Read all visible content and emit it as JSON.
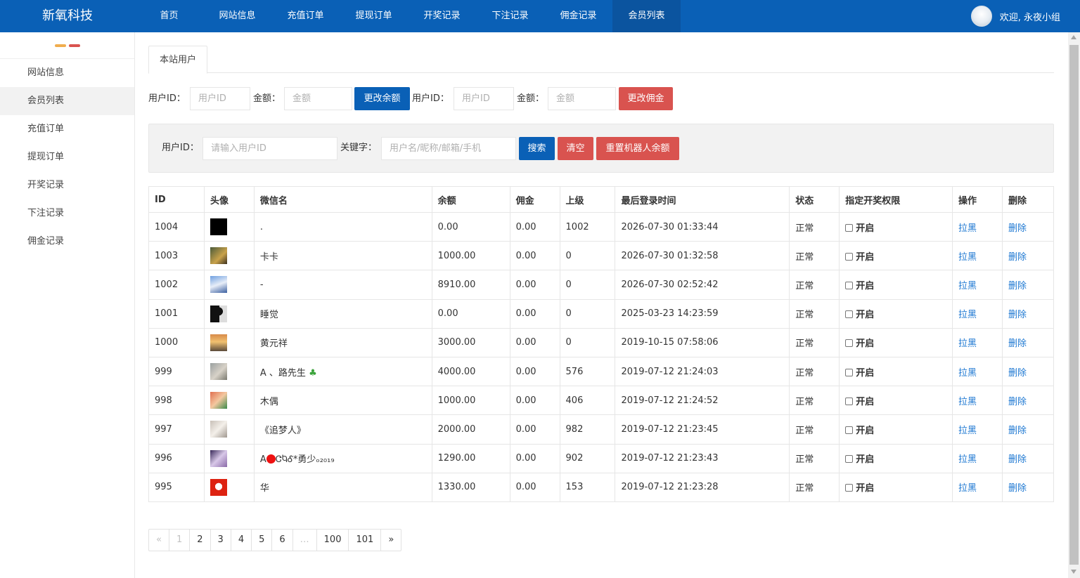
{
  "brand": "新氧科技",
  "nav": [
    "首页",
    "网站信息",
    "充值订单",
    "提现订单",
    "开奖记录",
    "下注记录",
    "佣金记录",
    "会员列表"
  ],
  "nav_active_index": 7,
  "user_greeting": "欢迎, 永夜小组",
  "sidebar": [
    "网站信息",
    "会员列表",
    "充值订单",
    "提现订单",
    "开奖记录",
    "下注记录",
    "佣金记录"
  ],
  "sidebar_active_index": 1,
  "tab": "本站用户",
  "balance_form": {
    "uid_label": "用户ID：",
    "uid_placeholder": "用户ID",
    "amount_label": "金额：",
    "amount_placeholder": "金额",
    "button": "更改余额"
  },
  "commission_form": {
    "uid_label": "用户ID：",
    "uid_placeholder": "用户ID",
    "amount_label": "金额：",
    "amount_placeholder": "金额",
    "button": "更改佣金"
  },
  "search": {
    "uid_label": "用户ID：",
    "uid_placeholder": "请输入用户ID",
    "kw_label": "关键字：",
    "kw_placeholder": "用户名/昵称/邮箱/手机",
    "search_button": "搜索",
    "clear_button": "清空",
    "reset_button": "重置机器人余额"
  },
  "table": {
    "headers": [
      "ID",
      "头像",
      "微信名",
      "余额",
      "佣金",
      "上级",
      "最后登录时间",
      "状态",
      "指定开奖权限",
      "操作",
      "删除"
    ],
    "rows": [
      {
        "id": "1004",
        "name": ".",
        "balance": "0.00",
        "commission": "0.00",
        "parent": "1002",
        "last_login": "2026-07-30 01:33:44",
        "status": "正常",
        "perm": "开启",
        "op": "拉黑",
        "del": "删除"
      },
      {
        "id": "1003",
        "name": "卡卡",
        "balance": "1000.00",
        "commission": "0.00",
        "parent": "0",
        "last_login": "2026-07-30 01:32:58",
        "status": "正常",
        "perm": "开启",
        "op": "拉黑",
        "del": "删除"
      },
      {
        "id": "1002",
        "name": "-",
        "balance": "8910.00",
        "commission": "0.00",
        "parent": "0",
        "last_login": "2026-07-30 02:52:42",
        "status": "正常",
        "perm": "开启",
        "op": "拉黑",
        "del": "删除"
      },
      {
        "id": "1001",
        "name": "睡觉",
        "balance": "0.00",
        "commission": "0.00",
        "parent": "0",
        "last_login": "2025-03-23 14:23:59",
        "status": "正常",
        "perm": "开启",
        "op": "拉黑",
        "del": "删除"
      },
      {
        "id": "1000",
        "name": "黄元祥",
        "balance": "3000.00",
        "commission": "0.00",
        "parent": "0",
        "last_login": "2019-10-15 07:58:06",
        "status": "正常",
        "perm": "开启",
        "op": "拉黑",
        "del": "删除"
      },
      {
        "id": "999",
        "name": "A 、路先生",
        "balance": "4000.00",
        "commission": "0.00",
        "parent": "576",
        "last_login": "2019-07-12 21:24:03",
        "status": "正常",
        "perm": "开启",
        "op": "拉黑",
        "del": "删除"
      },
      {
        "id": "998",
        "name": "木偶",
        "balance": "1000.00",
        "commission": "0.00",
        "parent": "406",
        "last_login": "2019-07-12 21:24:52",
        "status": "正常",
        "perm": "开启",
        "op": "拉黑",
        "del": "删除"
      },
      {
        "id": "997",
        "name": "《追梦人》",
        "balance": "2000.00",
        "commission": "0.00",
        "parent": "982",
        "last_login": "2019-07-12 21:23:45",
        "status": "正常",
        "perm": "开启",
        "op": "拉黑",
        "del": "删除"
      },
      {
        "id": "996",
        "name": "A",
        "name_tail": "ᏣႩᎴ*勇少ₒ₂₀₁₉",
        "balance": "1290.00",
        "commission": "0.00",
        "parent": "902",
        "last_login": "2019-07-12 21:23:43",
        "status": "正常",
        "perm": "开启",
        "op": "拉黑",
        "del": "删除"
      },
      {
        "id": "995",
        "name": "华",
        "balance": "1330.00",
        "commission": "0.00",
        "parent": "153",
        "last_login": "2019-07-12 21:23:28",
        "status": "正常",
        "perm": "开启",
        "op": "拉黑",
        "del": "删除"
      }
    ]
  },
  "pagination": [
    "«",
    "1",
    "2",
    "3",
    "4",
    "5",
    "6",
    "…",
    "100",
    "101",
    "»"
  ],
  "colors": {
    "primary": "#0a60b6",
    "danger": "#d9534f",
    "link": "#1e78d2"
  }
}
